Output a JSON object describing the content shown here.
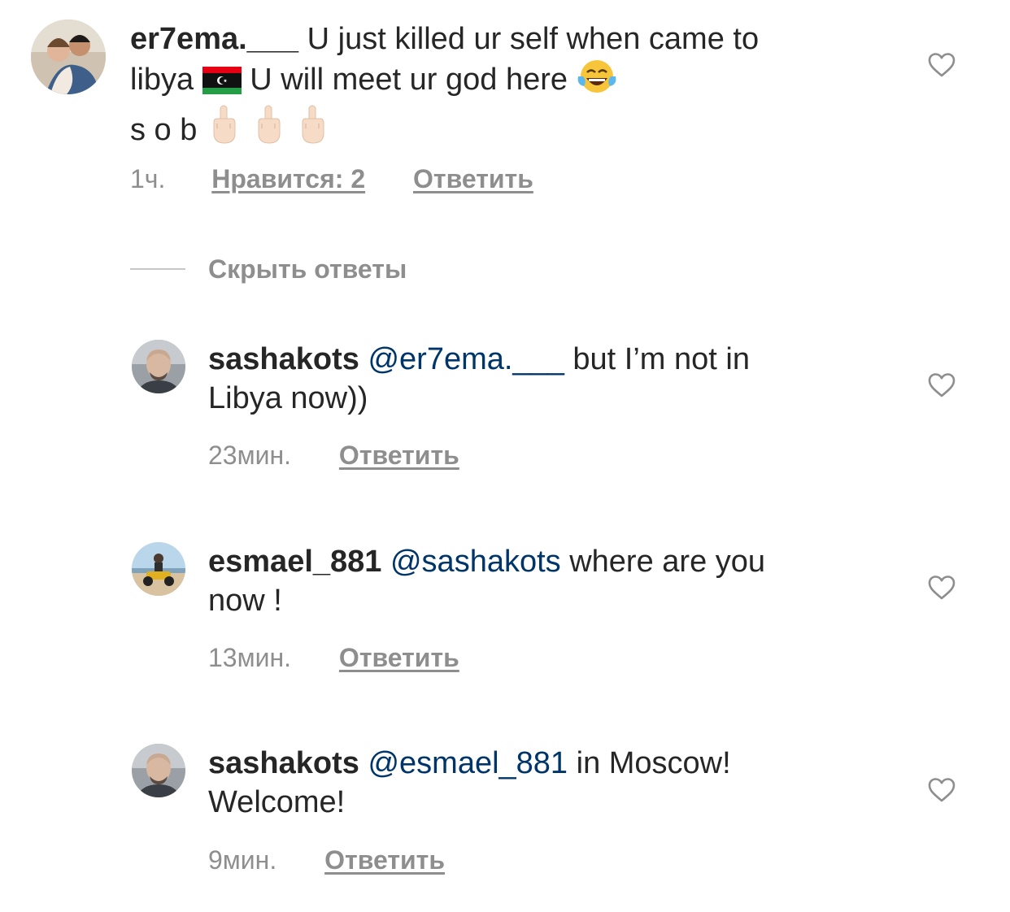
{
  "comments": [
    {
      "username": "er7ema.___",
      "text_line1": "U just killed ur self when came to",
      "text_line2a": "libya",
      "text_line2b": "U will meet ur god here",
      "text_line3": "s o b",
      "time": "1ч.",
      "likes": "Нравится: 2",
      "reply": "Ответить"
    },
    {
      "username": "sashakots",
      "mention": "@er7ema.___",
      "text": "but I’m not in",
      "text_line2": "Libya now))",
      "time": "23мин.",
      "reply": "Ответить"
    },
    {
      "username": "esmael_881",
      "mention": "@sashakots",
      "text": "where are you",
      "text_line2": "now !",
      "time": "13мин.",
      "reply": "Ответить"
    },
    {
      "username": "sashakots",
      "mention": "@esmael_881",
      "text": "in Moscow!",
      "text_line2": "Welcome!",
      "time": "9мин.",
      "reply": "Ответить"
    }
  ],
  "hide_replies_label": "Скрыть ответы",
  "icons": {
    "like": "heart-outline-icon",
    "flag": "libya-flag-icon",
    "laugh": "face-with-tears-of-joy-icon",
    "gesture": "middle-finger-icon"
  },
  "colors": {
    "text": "#262626",
    "secondary": "#8e8e8e",
    "mention": "#003569"
  }
}
